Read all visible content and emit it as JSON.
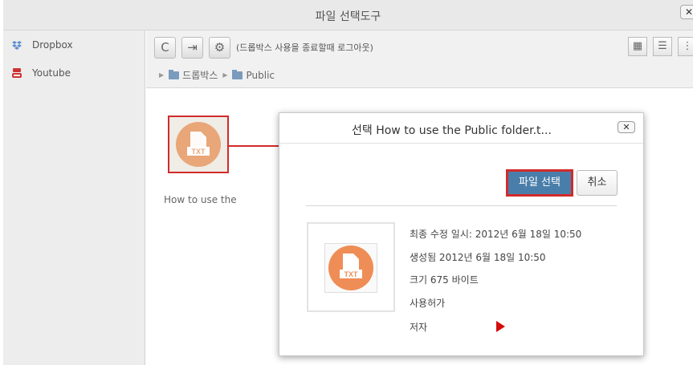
{
  "window": {
    "title": "파일 선택도구",
    "close_label": "✕"
  },
  "sidebar": {
    "items": [
      {
        "label": "Dropbox",
        "icon": "dropbox-icon"
      },
      {
        "label": "Youtube",
        "icon": "youtube-icon"
      }
    ]
  },
  "toolbar": {
    "refresh_icon": "C",
    "logout_icon": "⇥",
    "settings_icon": "⚙",
    "logout_text": "(드롭박스 사용을 종료할때 로그아웃)",
    "view_icons": [
      "▦",
      "☰",
      "⋮"
    ]
  },
  "breadcrumb": {
    "separator": "▶",
    "items": [
      "드롭박스",
      "Public"
    ]
  },
  "files": [
    {
      "name": "How to use the",
      "badge": "TXT"
    }
  ],
  "dialog": {
    "title": "선택 How to use the Public folder.t...",
    "close_label": "✕",
    "select_button": "파일 선택",
    "cancel_button": "취소",
    "badge": "TXT",
    "last_modified": "최종 수정 일시: 2012년 6월 18일 10:50",
    "created": "생성됨 2012년 6월 18일 10:50",
    "size": "크기 675 바이트",
    "license": "사용허가",
    "author": "저자"
  },
  "colors": {
    "accent_red": "#d12b2b",
    "select_button": "#4a7eaa",
    "file_icon": "#ef8d56"
  }
}
